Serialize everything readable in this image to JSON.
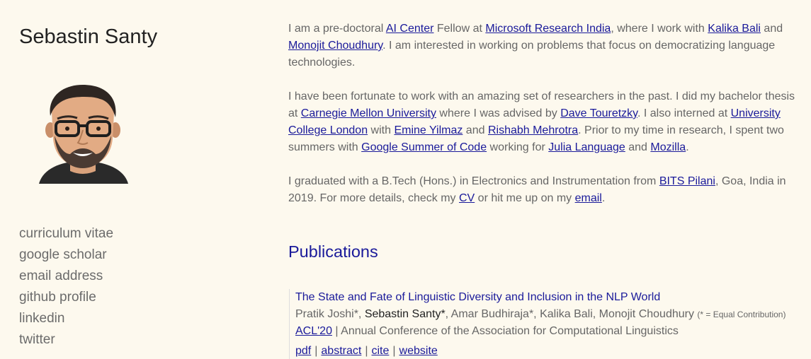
{
  "sidebar": {
    "title": "Sebastin Santy",
    "links": [
      "curriculum vitae",
      "google scholar",
      "email address",
      "github profile",
      "linkedin",
      "twitter"
    ]
  },
  "intro": {
    "p1": {
      "t1": "I am a pre-doctoral ",
      "l1": "AI Center",
      "t2": " Fellow at ",
      "l2": "Microsoft Research India",
      "t3": ", where I work with ",
      "l3": "Kalika Bali",
      "t4": " and ",
      "l4": "Monojit Choudhury",
      "t5": ". I am interested in working on problems that focus on democratizing language technologies."
    },
    "p2": {
      "t1": "I have been fortunate to work with an amazing set of researchers in the past. I did my bachelor thesis at ",
      "l1": "Carnegie Mellon University",
      "t2": " where I was advised by ",
      "l2": "Dave Touretzky",
      "t3": ". I also interned at ",
      "l3": "University College London",
      "t4": " with ",
      "l4": "Emine Yilmaz",
      "t5": " and ",
      "l5": "Rishabh Mehrotra",
      "t6": ". Prior to my time in research, I spent two summers with ",
      "l6": "Google Summer of Code",
      "t7": " working for ",
      "l7": "Julia Language",
      "t8": " and ",
      "l8": "Mozilla",
      "t9": "."
    },
    "p3": {
      "t1": "I graduated with a B.Tech (Hons.) in Electronics and Instrumentation from ",
      "l1": "BITS Pilani",
      "t2": ", Goa, India in 2019. For more details, check my ",
      "l2": "CV",
      "t3": " or hit me up on my ",
      "l3": "email",
      "t4": "."
    }
  },
  "publications": {
    "heading": "Publications",
    "items": [
      {
        "title": "The State and Fate of Linguistic Diversity and Inclusion in the NLP World",
        "authors_before": "Pratik Joshi*, ",
        "authors_me": "Sebastin Santy*",
        "authors_after": ", Amar Budhiraja*, Kalika Bali, Monojit Choudhury ",
        "note": "(* = Equal Contribution)",
        "venue_link": "ACL'20",
        "venue_text": " | Annual Conference of the Association for Computational Linguistics",
        "links": [
          "pdf",
          "abstract",
          "cite",
          "website"
        ],
        "separator": "|"
      }
    ]
  }
}
